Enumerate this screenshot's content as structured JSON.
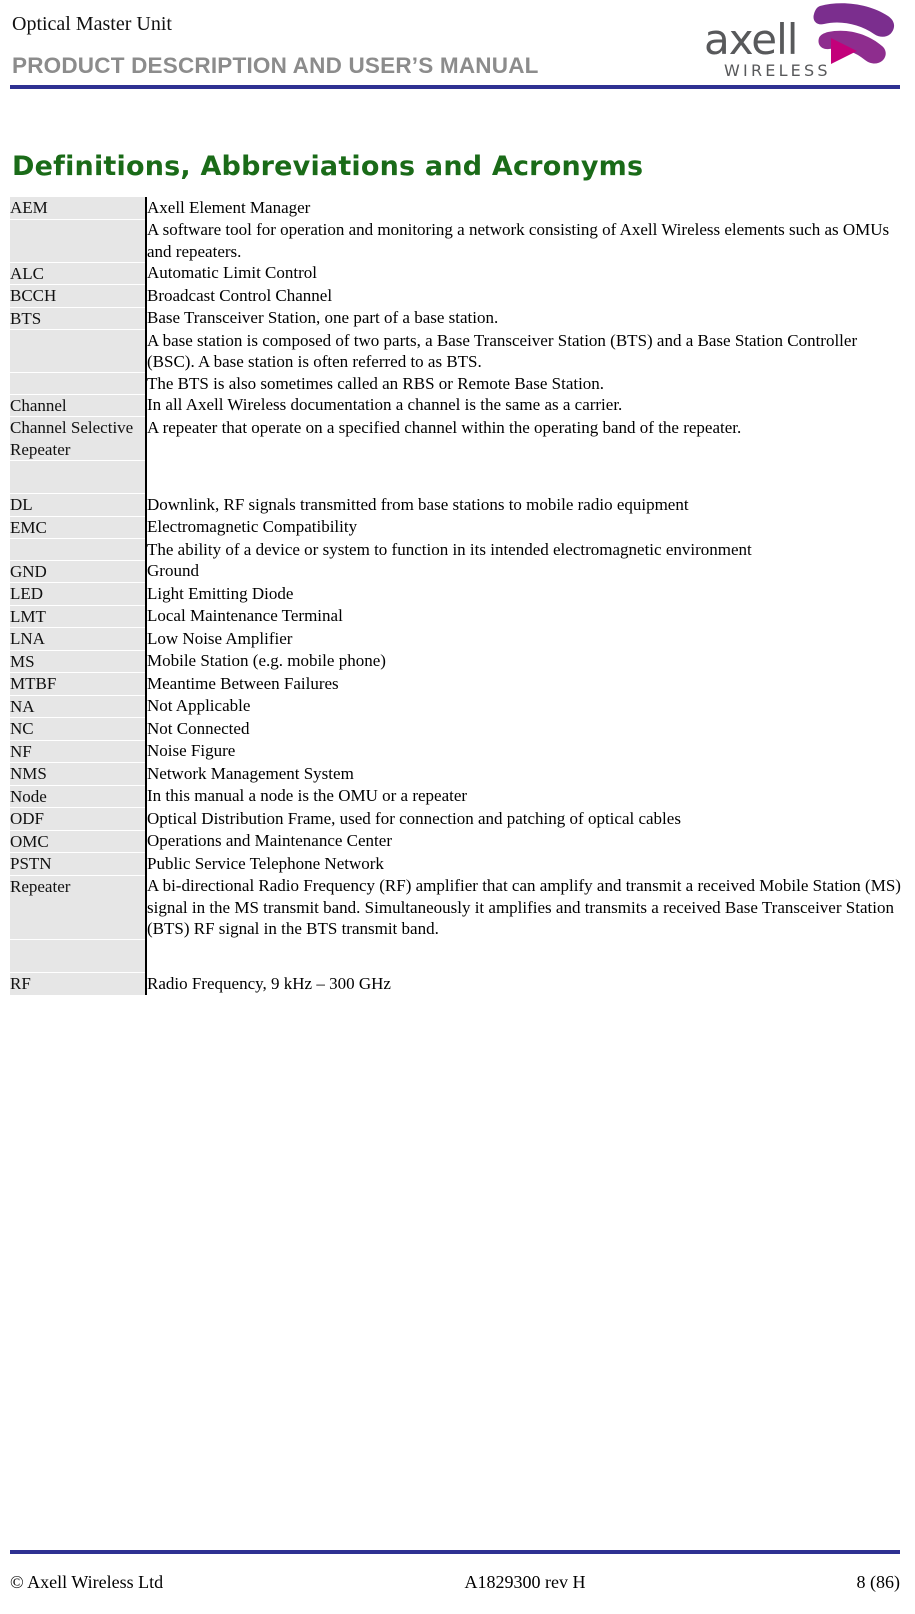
{
  "header": {
    "product_name": "Optical Master Unit",
    "document_title": "PRODUCT DESCRIPTION AND USER’S MANUAL",
    "rule_color": "#2e3192",
    "logo": {
      "wordmark": "axell",
      "tagline": "WIRELESS",
      "wordmark_color": "#58595b",
      "chevron_color_primary": "#7b2e8e",
      "chevron_color_secondary": "#c3007a"
    }
  },
  "section": {
    "heading": "Definitions, Abbreviations and Acronyms",
    "heading_color": "#1a6b18"
  },
  "glossary": {
    "rows": [
      {
        "term": "AEM",
        "definition": "Axell Element Manager",
        "first": true
      },
      {
        "term": "",
        "definition": "A software tool for operation and monitoring a network consisting of Axell Wireless elements such as OMUs and repeaters.",
        "first": false
      },
      {
        "term": "ALC",
        "definition": "Automatic Limit Control",
        "first": false
      },
      {
        "term": "BCCH",
        "definition": "Broadcast Control Channel",
        "first": false
      },
      {
        "term": "BTS",
        "definition": "Base Transceiver Station, one part of a base station.",
        "first": false
      },
      {
        "term": "",
        "definition": "A base station is composed of two parts, a Base Transceiver Station (BTS) and a Base Station Controller (BSC). A base station is often referred to as BTS.",
        "first": false
      },
      {
        "term": "",
        "definition": "The BTS is also sometimes called an RBS or Remote Base Station.",
        "first": false
      },
      {
        "term": "Channel",
        "definition": "In all Axell Wireless documentation a channel is the same as a carrier.",
        "first": false
      },
      {
        "term": "Channel Selective Repeater",
        "definition": "A repeater that operate on a specified channel within the operating band of the repeater.",
        "first": false
      },
      {
        "term": "",
        "definition": "",
        "first": false
      },
      {
        "term": "DL",
        "definition": "Downlink, RF signals transmitted from base stations to mobile radio equipment",
        "first": false
      },
      {
        "term": "EMC",
        "definition": "Electromagnetic Compatibility",
        "first": false
      },
      {
        "term": "",
        "definition": "The ability of a device or system to function in its intended electromagnetic environment",
        "first": false
      },
      {
        "term": "GND",
        "definition": "Ground",
        "first": false
      },
      {
        "term": "LED",
        "definition": "Light Emitting Diode",
        "first": false
      },
      {
        "term": "LMT",
        "definition": "Local Maintenance Terminal",
        "first": false
      },
      {
        "term": "LNA",
        "definition": "Low Noise Amplifier",
        "first": false
      },
      {
        "term": "MS",
        "definition": "Mobile Station (e.g. mobile phone)",
        "first": false
      },
      {
        "term": "MTBF",
        "definition": "Meantime Between Failures",
        "first": false
      },
      {
        "term": "NA",
        "definition": "Not Applicable",
        "first": false
      },
      {
        "term": "NC",
        "definition": "Not Connected",
        "first": false
      },
      {
        "term": "NF",
        "definition": "Noise Figure",
        "first": false
      },
      {
        "term": "NMS",
        "definition": "Network Management System",
        "first": false
      },
      {
        "term": "Node",
        "definition": "In this manual a node is the OMU or a repeater",
        "first": false
      },
      {
        "term": "ODF",
        "definition": "Optical Distribution Frame, used for connection and patching of optical cables",
        "first": false
      },
      {
        "term": "OMC",
        "definition": "Operations and Maintenance Center",
        "first": false
      },
      {
        "term": "PSTN",
        "definition": "Public Service Telephone Network",
        "first": false
      },
      {
        "term": "Repeater",
        "definition": "A bi-directional Radio Frequency (RF) amplifier that can amplify and transmit a received Mobile Station (MS) signal in the MS transmit band. Simultaneously it amplifies and transmits a received Base Transceiver Station (BTS) RF signal in the BTS transmit band.",
        "first": false
      },
      {
        "term": "",
        "definition": "",
        "first": false
      },
      {
        "term": "RF",
        "definition": "Radio Frequency, 9 kHz – 300 GHz",
        "first": false
      }
    ]
  },
  "footer": {
    "copyright": "© Axell Wireless Ltd",
    "document_id": "A1829300 rev H",
    "page_number": "8 (86)",
    "rule_color": "#2e3192"
  }
}
